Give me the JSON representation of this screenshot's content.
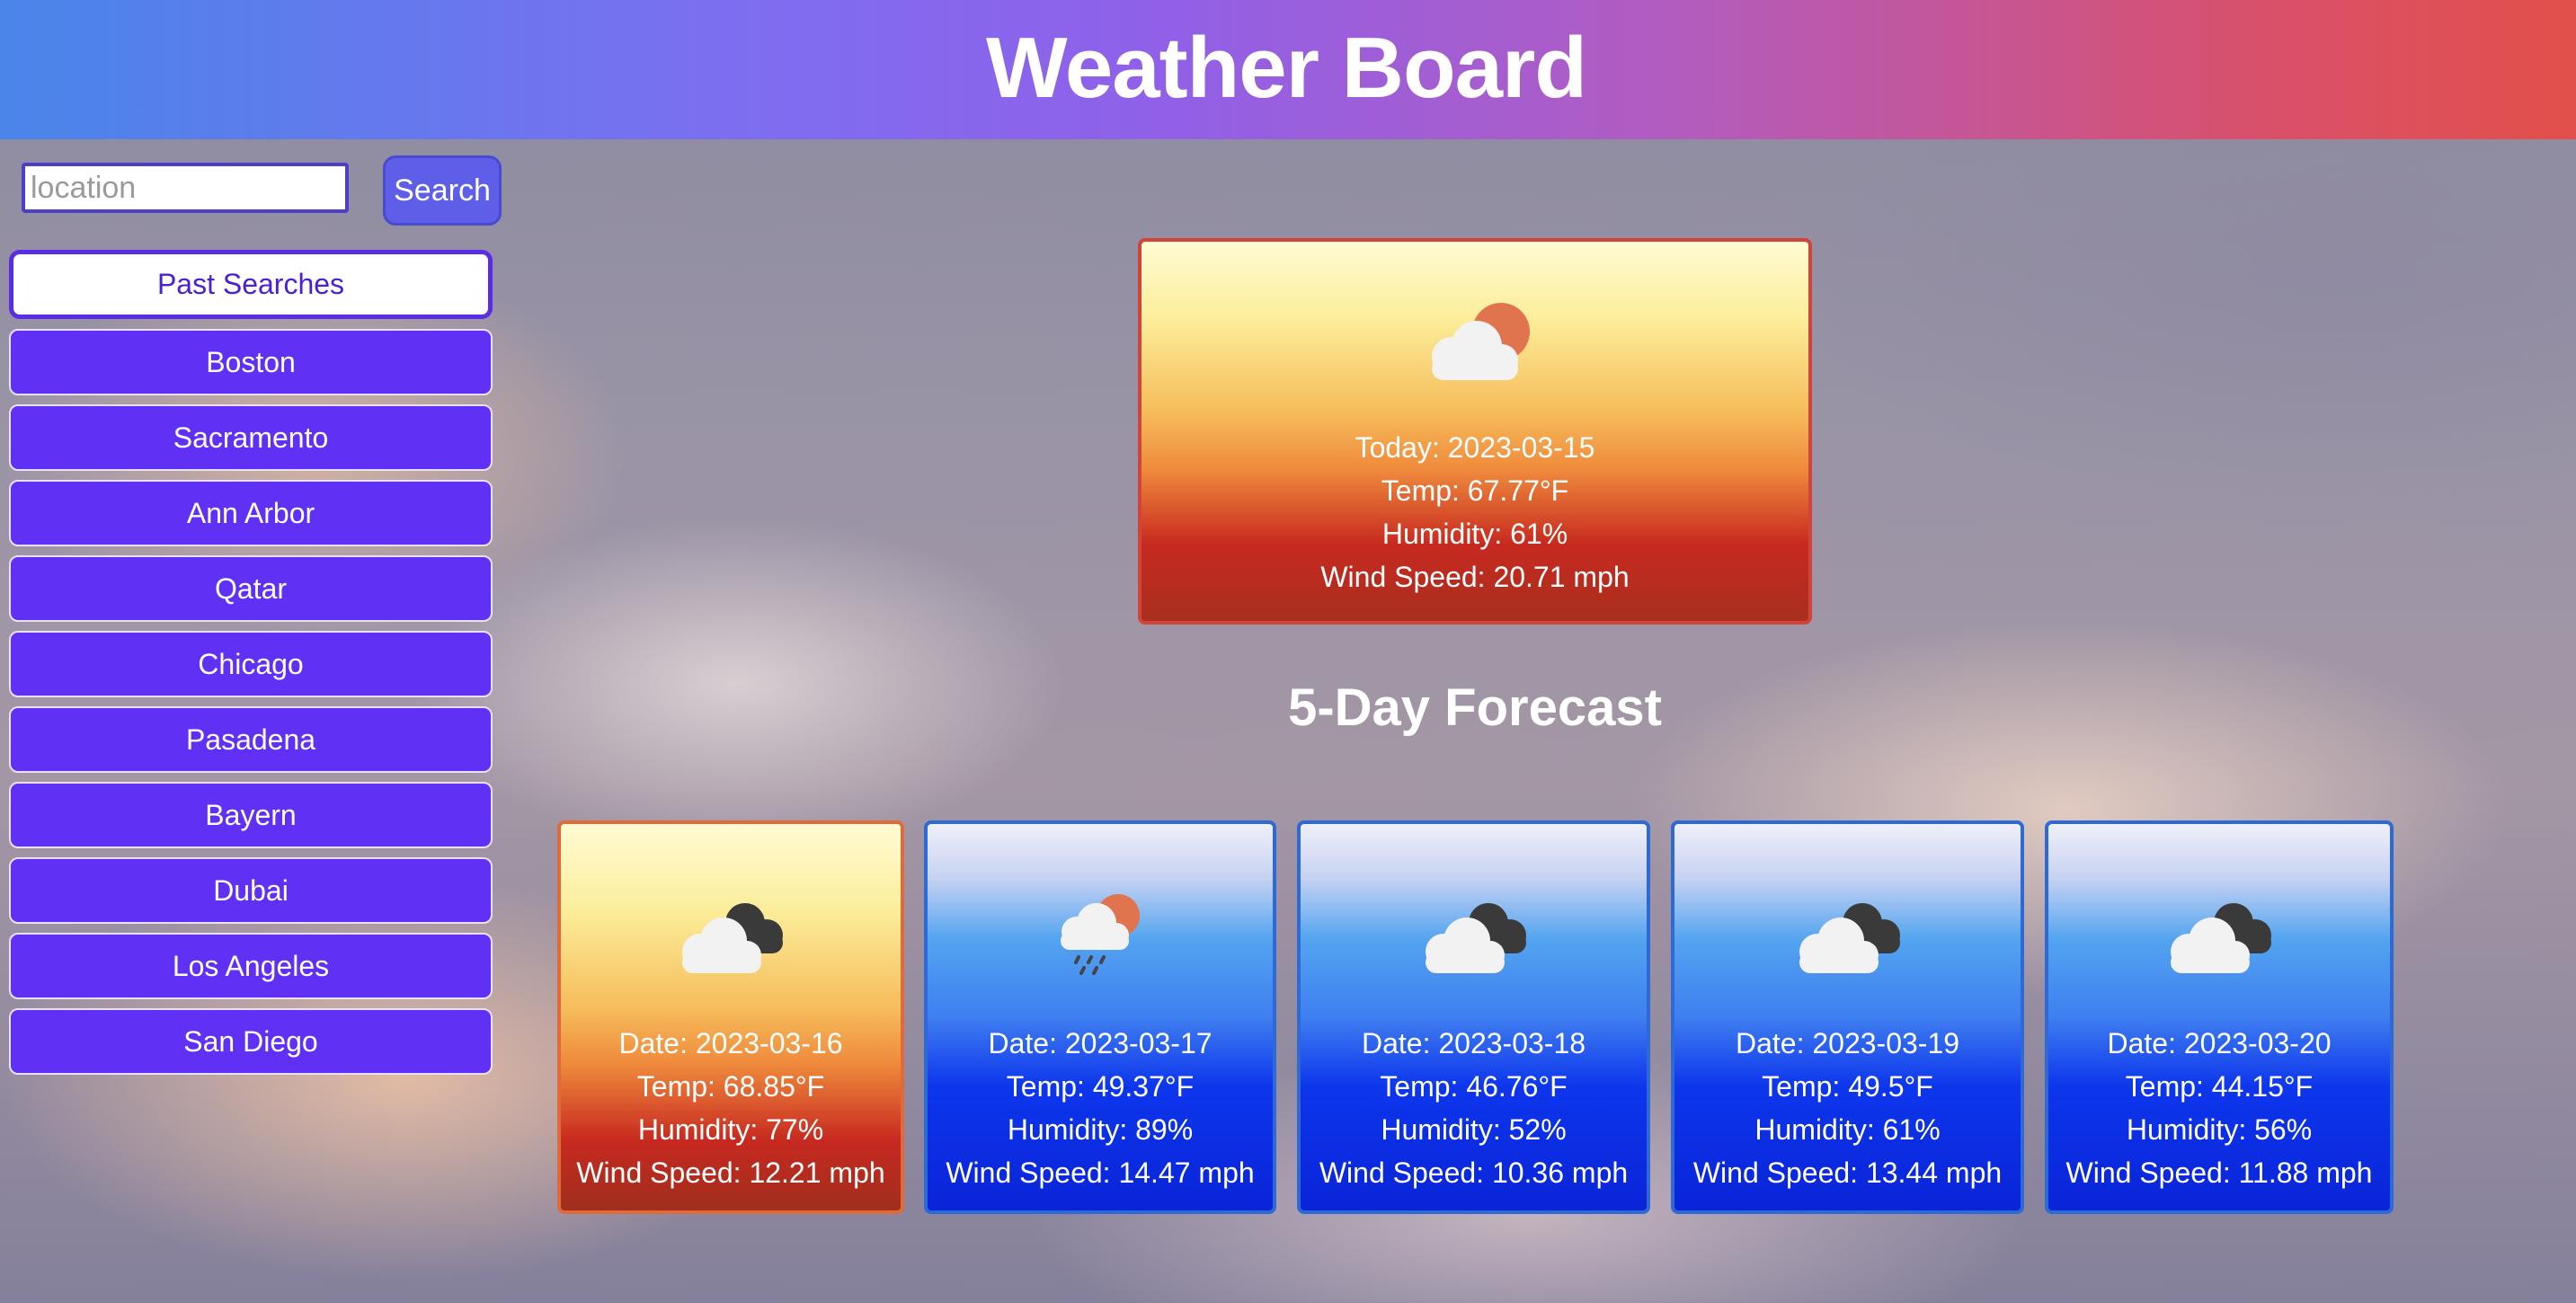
{
  "header": {
    "title": "Weather Board"
  },
  "search": {
    "placeholder": "location",
    "value": "",
    "button_label": "Search"
  },
  "past_searches": {
    "heading": "Past Searches",
    "cities": [
      "Boston",
      "Sacramento",
      "Ann Arbor",
      "Qatar",
      "Chicago",
      "Pasadena",
      "Bayern",
      "Dubai",
      "Los Angeles",
      "San Diego"
    ]
  },
  "today": {
    "icon": "partly-cloudy-sun-icon",
    "date_line": "Today: 2023-03-15",
    "temp_line": "Temp: 67.77°F",
    "humidity_line": "Humidity: 61%",
    "wind_line": "Wind Speed: 20.71 mph"
  },
  "forecast": {
    "title": "5-Day Forecast",
    "days": [
      {
        "icon": "broken-clouds-icon",
        "theme": "warm",
        "date_line": "Date: 2023-03-16",
        "temp_line": "Temp: 68.85°F",
        "humidity_line": "Humidity: 77%",
        "wind_line": "Wind Speed: 12.21 mph"
      },
      {
        "icon": "rain-sun-icon",
        "theme": "cool",
        "date_line": "Date: 2023-03-17",
        "temp_line": "Temp: 49.37°F",
        "humidity_line": "Humidity: 89%",
        "wind_line": "Wind Speed: 14.47 mph"
      },
      {
        "icon": "broken-clouds-icon",
        "theme": "cool",
        "date_line": "Date: 2023-03-18",
        "temp_line": "Temp: 46.76°F",
        "humidity_line": "Humidity: 52%",
        "wind_line": "Wind Speed: 10.36 mph"
      },
      {
        "icon": "broken-clouds-icon",
        "theme": "cool",
        "date_line": "Date: 2023-03-19",
        "temp_line": "Temp: 49.5°F",
        "humidity_line": "Humidity: 61%",
        "wind_line": "Wind Speed: 13.44 mph"
      },
      {
        "icon": "broken-clouds-icon",
        "theme": "cool",
        "date_line": "Date: 2023-03-20",
        "temp_line": "Temp: 44.15°F",
        "humidity_line": "Humidity: 56%",
        "wind_line": "Wind Speed: 11.88 mph"
      }
    ]
  },
  "colors": {
    "accent": "#6030f4",
    "warm_card": "#ef8a3c",
    "cool_card": "#0d36ec"
  }
}
